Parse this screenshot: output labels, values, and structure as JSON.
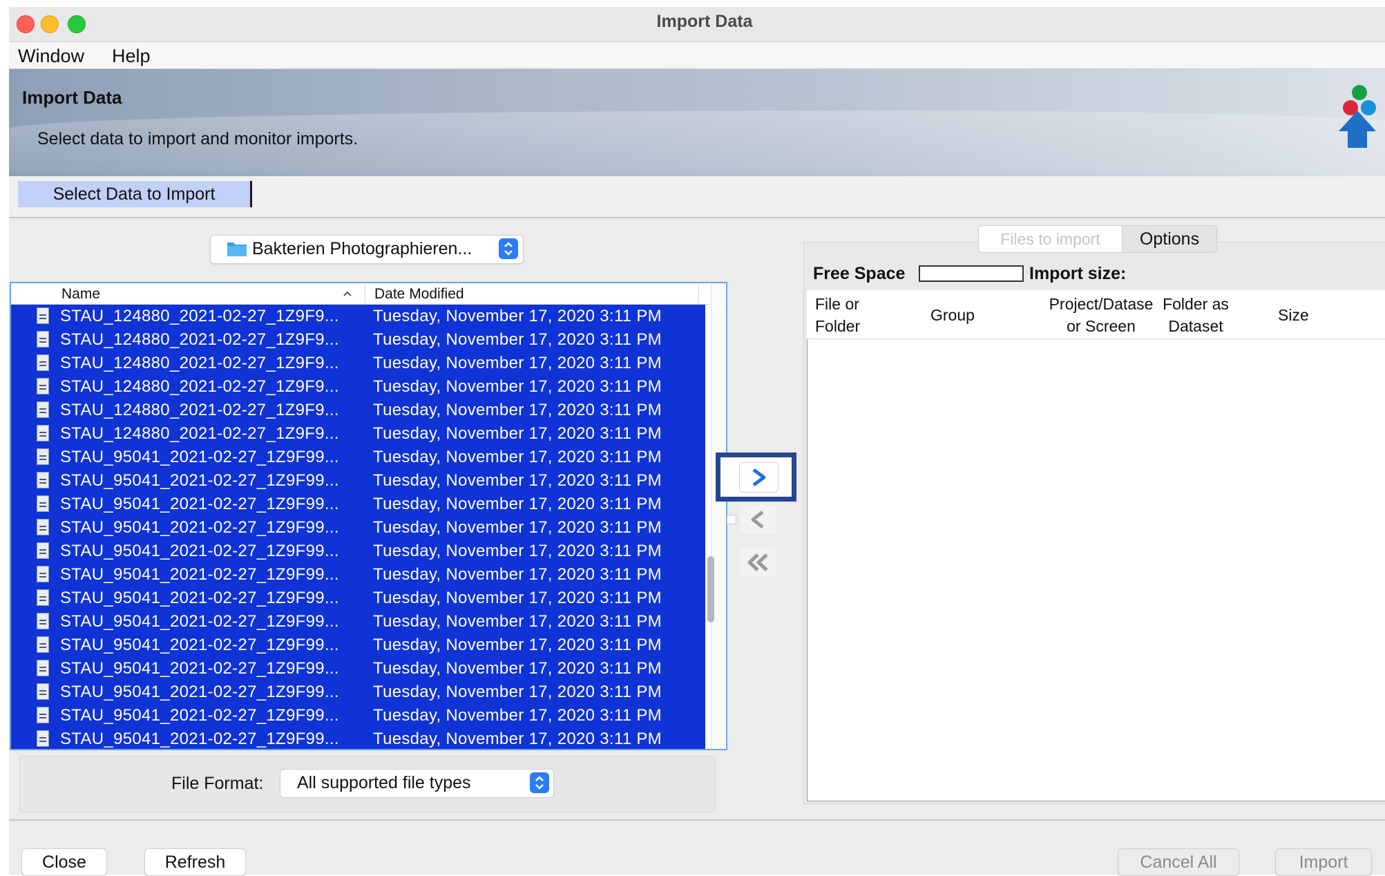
{
  "window": {
    "title": "Import Data",
    "menu": [
      "Window",
      "Help"
    ]
  },
  "banner": {
    "title": "Import Data",
    "subtitle": "Select data to import and monitor imports."
  },
  "tabs": {
    "select_label": "Select Data to Import"
  },
  "browser": {
    "folder_label": "Bakterien Photographieren...",
    "columns": {
      "name": "Name",
      "date": "Date Modified"
    },
    "files": [
      {
        "name": "STAU_124880_2021-02-27_1Z9F9...",
        "date": "Tuesday, November 17, 2020 3:11 PM"
      },
      {
        "name": "STAU_124880_2021-02-27_1Z9F9...",
        "date": "Tuesday, November 17, 2020 3:11 PM"
      },
      {
        "name": "STAU_124880_2021-02-27_1Z9F9...",
        "date": "Tuesday, November 17, 2020 3:11 PM"
      },
      {
        "name": "STAU_124880_2021-02-27_1Z9F9...",
        "date": "Tuesday, November 17, 2020 3:11 PM"
      },
      {
        "name": "STAU_124880_2021-02-27_1Z9F9...",
        "date": "Tuesday, November 17, 2020 3:11 PM"
      },
      {
        "name": "STAU_124880_2021-02-27_1Z9F9...",
        "date": "Tuesday, November 17, 2020 3:11 PM"
      },
      {
        "name": "STAU_95041_2021-02-27_1Z9F99...",
        "date": "Tuesday, November 17, 2020 3:11 PM"
      },
      {
        "name": "STAU_95041_2021-02-27_1Z9F99...",
        "date": "Tuesday, November 17, 2020 3:11 PM"
      },
      {
        "name": "STAU_95041_2021-02-27_1Z9F99...",
        "date": "Tuesday, November 17, 2020 3:11 PM"
      },
      {
        "name": "STAU_95041_2021-02-27_1Z9F99...",
        "date": "Tuesday, November 17, 2020 3:11 PM"
      },
      {
        "name": "STAU_95041_2021-02-27_1Z9F99...",
        "date": "Tuesday, November 17, 2020 3:11 PM"
      },
      {
        "name": "STAU_95041_2021-02-27_1Z9F99...",
        "date": "Tuesday, November 17, 2020 3:11 PM"
      },
      {
        "name": "STAU_95041_2021-02-27_1Z9F99...",
        "date": "Tuesday, November 17, 2020 3:11 PM"
      },
      {
        "name": "STAU_95041_2021-02-27_1Z9F99...",
        "date": "Tuesday, November 17, 2020 3:11 PM"
      },
      {
        "name": "STAU_95041_2021-02-27_1Z9F99...",
        "date": "Tuesday, November 17, 2020 3:11 PM"
      },
      {
        "name": "STAU_95041_2021-02-27_1Z9F99...",
        "date": "Tuesday, November 17, 2020 3:11 PM"
      },
      {
        "name": "STAU_95041_2021-02-27_1Z9F99...",
        "date": "Tuesday, November 17, 2020 3:11 PM"
      },
      {
        "name": "STAU_95041_2021-02-27_1Z9F99...",
        "date": "Tuesday, November 17, 2020 3:11 PM"
      },
      {
        "name": "STAU_95041_2021-02-27_1Z9F99...",
        "date": "Tuesday, November 17, 2020 3:11 PM"
      }
    ],
    "format_label": "File Format:",
    "format_value": "All supported file types"
  },
  "queue": {
    "tabs": {
      "files": "Files to import",
      "options": "Options"
    },
    "free_space_label": "Free Space",
    "import_size_label": "Import size:",
    "columns": {
      "file_or_folder": "File or Folder",
      "group": "Group",
      "project": "Project/Datase or Screen",
      "folder_as_dataset": "Folder as Dataset",
      "size": "Size"
    }
  },
  "buttons": {
    "close": "Close",
    "refresh": "Refresh",
    "cancel_all": "Cancel All",
    "import": "Import"
  },
  "icons": {
    "add": "chevron-right-icon",
    "remove": "chevron-left-icon",
    "remove_all": "double-chevron-left-icon",
    "logo": "omero-logo-icon",
    "folder": "folder-icon",
    "file": "file-icon",
    "sort": "sort-ascending-icon"
  },
  "colors": {
    "selection": "#0f33d4",
    "accent": "#2b7cf5",
    "highlight_box": "#28468f"
  }
}
